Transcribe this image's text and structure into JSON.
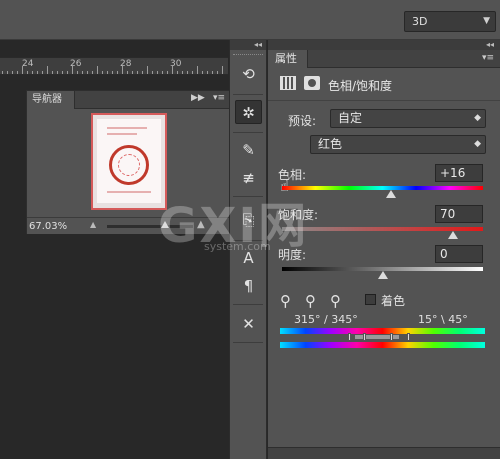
{
  "topbar": {
    "mode_value": "3D"
  },
  "ruler": {
    "labels": [
      "24",
      "26",
      "28",
      "30"
    ]
  },
  "navigator": {
    "tab_label": "导航器",
    "zoom_value": "67.03%",
    "zoom_level_fraction": 0.67
  },
  "tool_strip": {
    "icons": [
      "history-icon",
      "adjustments-icon",
      "brush-icon",
      "sliders-icon",
      "clone-source-icon",
      "character-icon",
      "paragraph-icon",
      "tools-icon"
    ],
    "glyphs": {
      "history": "⟲",
      "adjustments": "✲",
      "brush": "✎",
      "sliders": "≢",
      "clone": "⎘",
      "character": "A",
      "paragraph": "¶",
      "tools": "✕"
    }
  },
  "properties": {
    "tab_label": "属性",
    "adjustment_title": "色相/饱和度",
    "preset_label": "预设:",
    "preset_value": "自定",
    "channel_value": "红色",
    "hue": {
      "label": "色相:",
      "value": "+16",
      "level": 0.544
    },
    "saturation": {
      "label": "饱和度:",
      "value": "70",
      "level": 0.85
    },
    "lightness": {
      "label": "明度:",
      "value": "0",
      "level": 0.5
    },
    "colorize_label": "着色",
    "range_left": "315° / 345°",
    "range_right": "15° \\ 45°"
  },
  "watermark": {
    "main": "GXI网",
    "sub": "system.com"
  },
  "colors": {
    "panel": "#535353",
    "dark": "#282828",
    "accent_red": "#d55a5a"
  }
}
